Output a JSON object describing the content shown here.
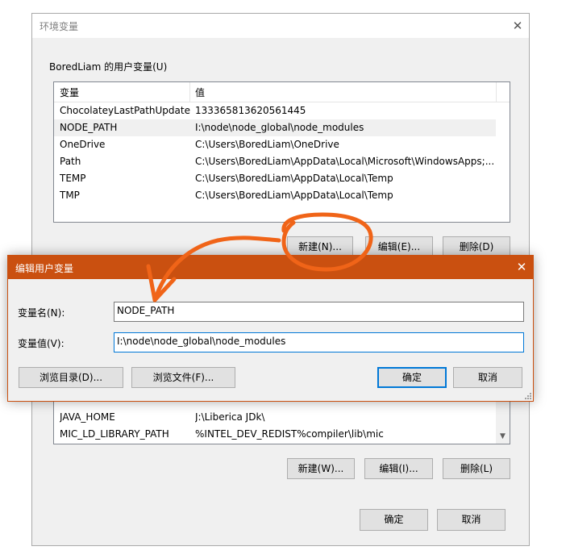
{
  "colors": {
    "accent": "#0078d7",
    "dialog_titlebar": "#ca5010",
    "annotation": "#f06418"
  },
  "env_window": {
    "title": "环境变量",
    "close_icon": "close-icon",
    "user_group_label": "BoredLiam 的用户变量(U)",
    "columns": {
      "name": "变量",
      "value": "值"
    },
    "user_vars": [
      {
        "name": "ChocolateyLastPathUpdate",
        "value": "133365813620561445"
      },
      {
        "name": "NODE_PATH",
        "value": "I:\\node\\node_global\\node_modules"
      },
      {
        "name": "OneDrive",
        "value": "C:\\Users\\BoredLiam\\OneDrive"
      },
      {
        "name": "Path",
        "value": "C:\\Users\\BoredLiam\\AppData\\Local\\Microsoft\\WindowsApps;..."
      },
      {
        "name": "TEMP",
        "value": "C:\\Users\\BoredLiam\\AppData\\Local\\Temp"
      },
      {
        "name": "TMP",
        "value": "C:\\Users\\BoredLiam\\AppData\\Local\\Temp"
      }
    ],
    "user_buttons": {
      "new": "新建(N)...",
      "edit": "编辑(E)...",
      "delete": "删除(D)"
    },
    "sys_vars": [
      {
        "name": "JAVA_HOME",
        "value": "J:\\Liberica JDk\\"
      },
      {
        "name": "MIC_LD_LIBRARY_PATH",
        "value": "%INTEL_DEV_REDIST%compiler\\lib\\mic"
      }
    ],
    "sys_buttons": {
      "new": "新建(W)...",
      "edit": "编辑(I)...",
      "delete": "删除(L)"
    },
    "ok": "确定",
    "cancel": "取消"
  },
  "edit_dialog": {
    "title": "编辑用户变量",
    "close_icon": "close-icon",
    "name_label": "变量名(N):",
    "name_value": "NODE_PATH",
    "value_label": "变量值(V):",
    "value_value": "I:\\node\\node_global\\node_modules",
    "browse_dir": "浏览目录(D)...",
    "browse_file": "浏览文件(F)...",
    "ok": "确定",
    "cancel": "取消"
  }
}
